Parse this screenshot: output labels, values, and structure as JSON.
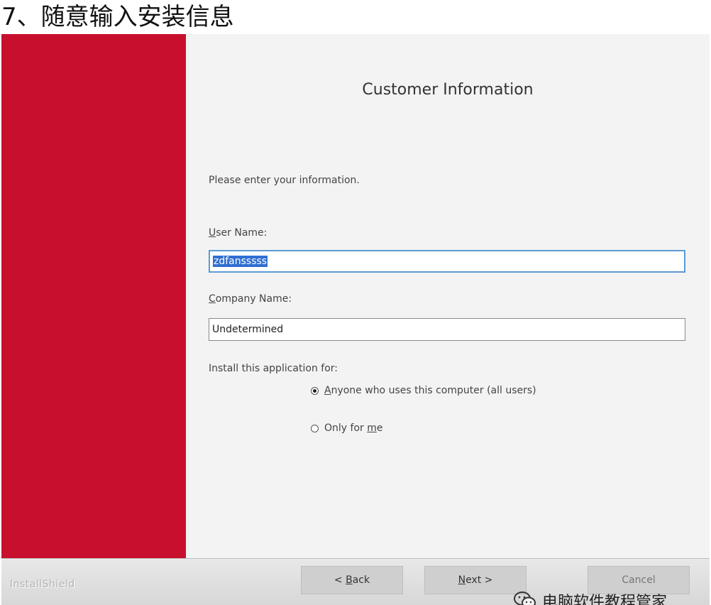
{
  "caption": "7、随意输入安装信息",
  "dialog": {
    "title": "Customer Information",
    "prompt": "Please enter your information.",
    "user_name": {
      "label_mnemonic": "U",
      "label_rest": "ser Name:",
      "value": "zdfansssss"
    },
    "company_name": {
      "label_mnemonic": "C",
      "label_rest": "ompany Name:",
      "value": "Undetermined"
    },
    "install_for": {
      "label": "Install this application for:",
      "options": [
        {
          "mnemonic": "A",
          "rest": "nyone who uses this computer (all users)",
          "checked": true
        },
        {
          "prefix": "Only for ",
          "mnemonic": "m",
          "rest": "e",
          "checked": false
        }
      ]
    },
    "footer": {
      "brand": "InstallShield",
      "back_label_prefix": "< ",
      "back_label_mnemonic": "B",
      "back_label_rest": "ack",
      "next_label_mnemonic": "N",
      "next_label_rest": "ext >",
      "cancel_label": "Cancel"
    },
    "watermark": "电脑软件教程管家"
  },
  "colors": {
    "side_panel": "#c8102e",
    "selection": "#2f6fd1",
    "focus_border": "#5b9bd5"
  }
}
